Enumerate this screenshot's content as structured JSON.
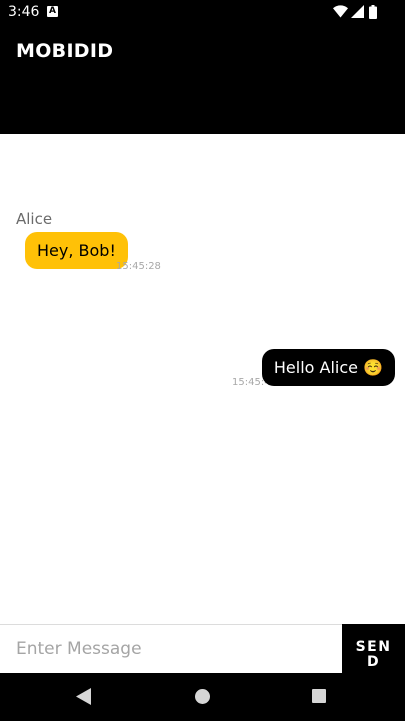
{
  "status_bar": {
    "time": "3:46",
    "icons": [
      "accessibility-a-icon",
      "wifi-icon",
      "signal-icon",
      "battery-icon"
    ]
  },
  "app_bar": {
    "title": "MOBIDID"
  },
  "messages": [
    {
      "sender": "Alice",
      "text": "Hey, Bob!",
      "time": "15:45:28",
      "direction": "incoming",
      "bubble_color": "#ffc107"
    },
    {
      "sender": "",
      "text": "Hello Alice ☺️",
      "time": "15:45:41",
      "direction": "outgoing",
      "bubble_color": "#000000"
    }
  ],
  "composer": {
    "placeholder": "Enter Message",
    "value": "",
    "send_label": "SEND"
  },
  "nav_bar": {
    "icons": [
      "back-icon",
      "home-icon",
      "recents-icon"
    ]
  },
  "colors": {
    "primary": "#000000",
    "accent": "#ffc107",
    "background": "#ffffff"
  }
}
